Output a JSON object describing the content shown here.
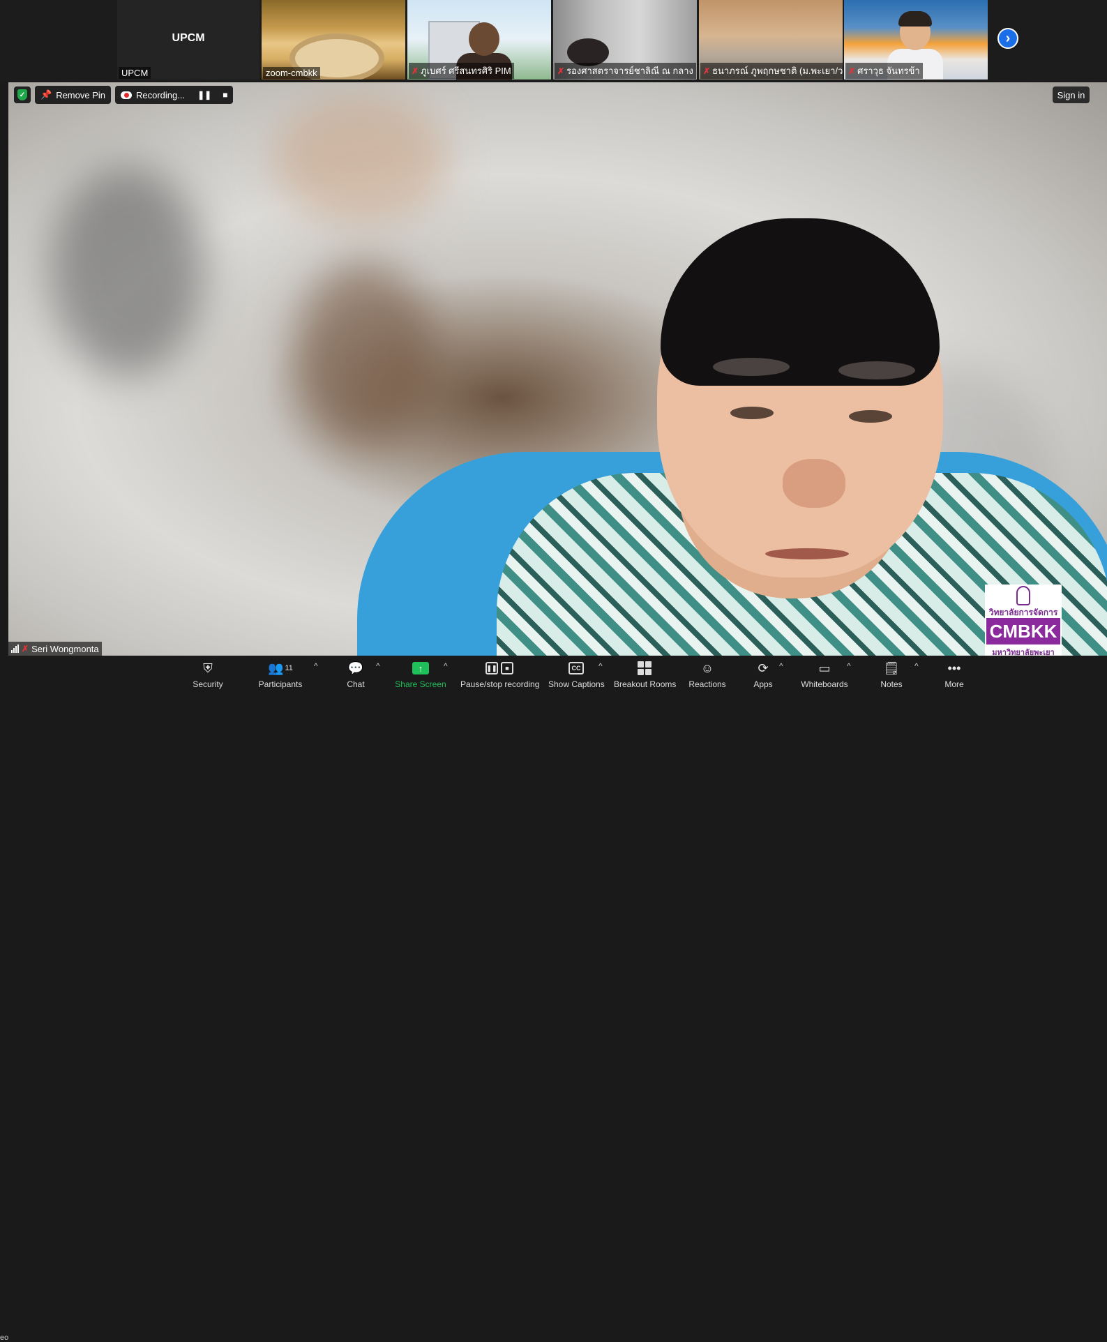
{
  "gallery": {
    "tiles": [
      {
        "name": "UPCM",
        "label": "UPCM",
        "muted": false
      },
      {
        "name": "",
        "label": "zoom-cmbkk",
        "muted": false
      },
      {
        "name": "",
        "label": "ภูเบศร์ ศรีสนทรศิริ PIM",
        "muted": true
      },
      {
        "name": "",
        "label": "รองศาสตราจารย์ชาลิณี ณ กลาง",
        "muted": true
      },
      {
        "name": "",
        "label": "ธนาภรณ์ ภูพฤกษชาติ (ม.พะเยา/ว....",
        "muted": true
      },
      {
        "name": "",
        "label": "ศราวุธ จันทรข้า",
        "muted": true
      }
    ],
    "next_icon": "chevron-right-icon"
  },
  "meeting_toolbar": {
    "remove_pin_label": "Remove Pin",
    "recording_label": "Recording...",
    "pause_glyph": "❚❚",
    "stop_glyph": "■"
  },
  "sign_in_label": "Sign in",
  "active_speaker": {
    "name": "Seri Wongmonta",
    "muted": true
  },
  "logo": {
    "thai_top": "วิทยาลัยการจัดการ",
    "brand": "CMBKK",
    "thai_bottom": "มหาวิทยาลัยพะเยา"
  },
  "left_edge_text": "eo",
  "controls": {
    "security": {
      "label": "Security",
      "icon": "shield-icon"
    },
    "participants": {
      "label": "Participants",
      "count": "11",
      "icon": "people-icon"
    },
    "chat": {
      "label": "Chat",
      "icon": "chat-bubble-icon"
    },
    "share_screen": {
      "label": "Share Screen",
      "icon": "share-arrow-icon",
      "color": "#1fbf5a"
    },
    "pause_stop_recording": {
      "label": "Pause/stop recording",
      "icon": "pause-stop-icon"
    },
    "show_captions": {
      "label": "Show Captions",
      "icon": "cc-icon"
    },
    "breakout_rooms": {
      "label": "Breakout Rooms",
      "icon": "grid-icon"
    },
    "reactions": {
      "label": "Reactions",
      "icon": "smiley-plus-icon"
    },
    "apps": {
      "label": "Apps",
      "icon": "apps-icon"
    },
    "whiteboards": {
      "label": "Whiteboards",
      "icon": "whiteboard-icon"
    },
    "notes": {
      "label": "Notes",
      "icon": "notes-icon"
    },
    "more": {
      "label": "More",
      "icon": "ellipsis-icon"
    }
  },
  "colors": {
    "accent_blue": "#1a6ee8",
    "muted_red": "#e5333a",
    "secure_green": "#1fa74a",
    "logo_purple": "#8a2a9c"
  }
}
